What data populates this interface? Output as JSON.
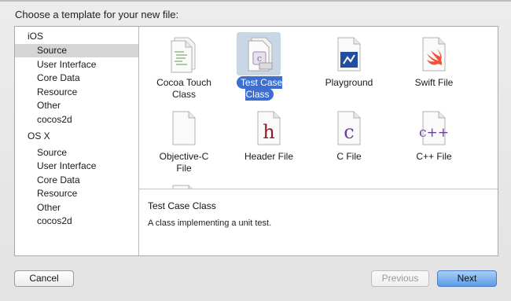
{
  "dialog": {
    "prompt": "Choose a template for your new file:"
  },
  "sidebar": {
    "groups": [
      {
        "label": "iOS",
        "items": [
          "Source",
          "User Interface",
          "Core Data",
          "Resource",
          "Other",
          "cocos2d"
        ]
      },
      {
        "label": "OS X",
        "items": [
          "Source",
          "User Interface",
          "Core Data",
          "Resource",
          "Other",
          "cocos2d"
        ]
      }
    ],
    "selected": "iOS / Source"
  },
  "templates": [
    {
      "label": "Cocoa Touch\nClass",
      "icon": "cocoa-touch-class-icon"
    },
    {
      "label": "Test Case Class",
      "icon": "test-case-class-icon",
      "selected": true
    },
    {
      "label": "Playground",
      "icon": "playground-icon"
    },
    {
      "label": "Swift File",
      "icon": "swift-file-icon"
    },
    {
      "label": "Objective-C\nFile",
      "icon": "objective-c-file-icon"
    },
    {
      "label": "Header File",
      "icon": "header-file-icon"
    },
    {
      "label": "C File",
      "icon": "c-file-icon"
    },
    {
      "label": "C++ File",
      "icon": "cpp-file-icon"
    }
  ],
  "description": {
    "title": "Test Case Class",
    "text": "A class implementing a unit test."
  },
  "buttons": {
    "cancel": "Cancel",
    "previous": "Previous",
    "next": "Next"
  },
  "colors": {
    "selection": "#3c6fd0",
    "swift": "#f05138",
    "header": "#8b1d2c",
    "c": "#6a3f9e",
    "playground": "#1f4fa0"
  }
}
